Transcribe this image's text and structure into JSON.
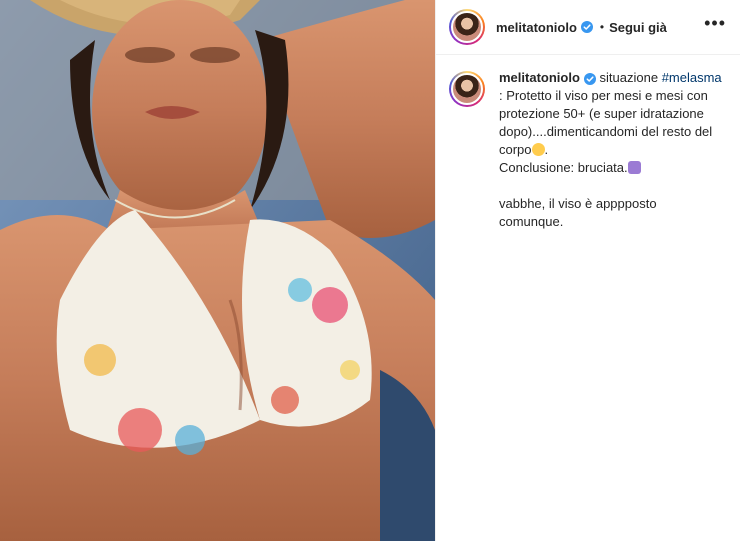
{
  "post": {
    "username": "melitatoniolo",
    "follow_label": "Segui già",
    "separator": "•",
    "more_label": "•••"
  },
  "caption": {
    "username": "melitatoniolo",
    "lead": "situazione",
    "hashtag": "#melasma",
    "line1": ": Protetto il viso per mesi e mesi con protezione 50+ (e super idratazione dopo)....dimenticandomi del resto del corpo",
    "line1_end": ".",
    "line2": "Conclusione: bruciata.",
    "line3": "vabbhe, il viso è apppposto comunque."
  },
  "colors": {
    "link": "#00376b",
    "verified": "#3897f0",
    "text": "#262626",
    "border": "#efefef"
  },
  "icons": {
    "verified": "verified-badge-icon",
    "more": "more-options-icon",
    "emoji_sweat": "sweat-smile-emoji",
    "emoji_facepalm": "facepalm-emoji"
  }
}
